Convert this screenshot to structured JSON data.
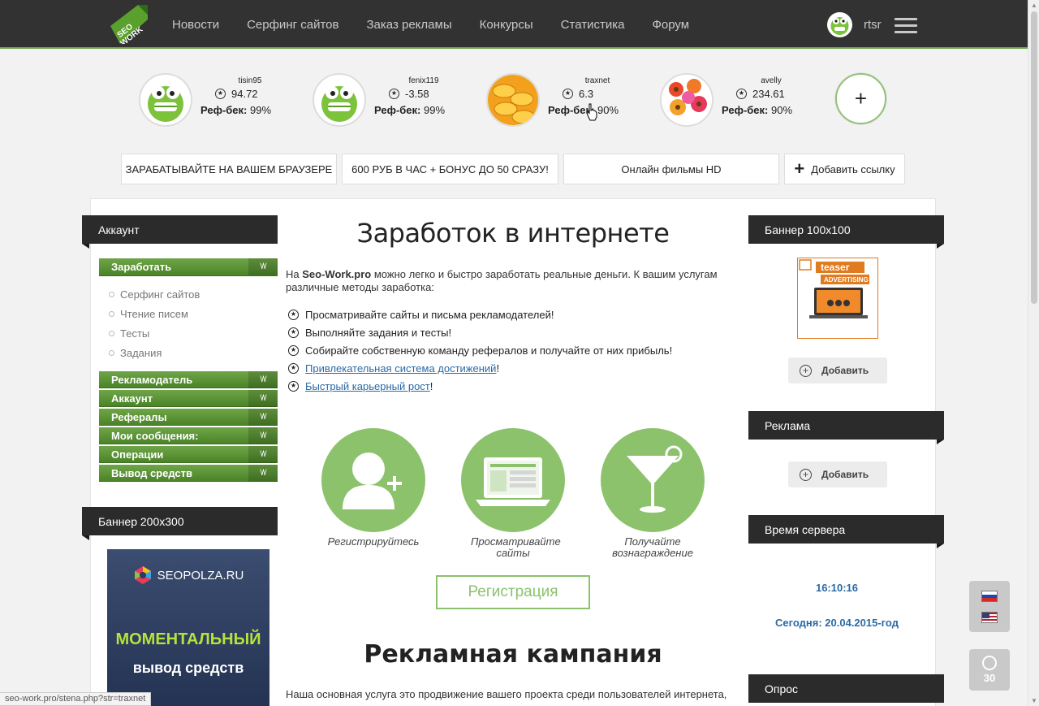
{
  "header": {
    "logo_text": "SEO WORK",
    "nav": [
      "Новости",
      "Серфинг сайтов",
      "Заказ рекламы",
      "Конкурсы",
      "Статистика",
      "Форум"
    ],
    "username": "rtsr"
  },
  "referrals": [
    {
      "nick": "tisin95",
      "points": "94.72",
      "label": "Реф-бек:",
      "value": "99%"
    },
    {
      "nick": "fenix119",
      "points": "-3.58",
      "label": "Реф-бек:",
      "value": "99%"
    },
    {
      "nick": "traxnet",
      "points": "6.3",
      "label": "Реф-бек:",
      "value": "90%"
    },
    {
      "nick": "avelly",
      "points": "234.61",
      "label": "Реф-бек:",
      "value": "90%"
    }
  ],
  "add_ref": "+",
  "links": [
    "ЗАРАБАТЫВАЙТЕ НА ВАШЕМ БРАУЗЕРЕ",
    "600 РУБ В ЧАС + БОНУС ДО 50 СРАЗУ!",
    "Онлайн фильмы HD",
    "Добавить ссылку"
  ],
  "left": {
    "account_title": "Аккаунт",
    "earn": "Заработать",
    "earn_items": [
      "Серфинг сайтов",
      "Чтение писем",
      "Тесты",
      "Задания"
    ],
    "sections": [
      "Рекламодатель",
      "Аккаунт",
      "Рефералы",
      "Мои сообщения:",
      "Операции",
      "Вывод средств"
    ],
    "chev": "\\/\\/",
    "banner_title": "Баннер 200x300",
    "banner": {
      "site": "SEOPOLZA.RU",
      "line1": "МОМЕНТАЛЬНЫЙ",
      "line2": "вывод средств"
    }
  },
  "center": {
    "title": "Заработок в интернете",
    "intro_pre": "На ",
    "intro_brand": "Seo-Work.pro",
    "intro_post": " можно легко и быстро заработать реальные деньги. К вашим услугам различные методы заработка:",
    "list": [
      "Просматривайте сайты и письма рекламодателей!",
      "Выполняйте задания и тесты!",
      "Собирайте собственную команду рефералов и получайте от них прибыль!"
    ],
    "links": [
      {
        "text": "Привлекательная система достижений",
        "tail": "!"
      },
      {
        "text": "Быстрый карьерный рост",
        "tail": "!"
      }
    ],
    "steps": [
      "Регистрируйтесь",
      "Просматривайте сайты",
      "Получайте вознаграждение"
    ],
    "register": "Регистрация",
    "title2": "Рекламная кампания",
    "para2": "Наша основная услуга это продвижение вашего проекта среди пользователей интернета,"
  },
  "right": {
    "banner_title": "Баннер 100x100",
    "teaser_text": "teaser",
    "teaser_sub": "ADVERTISING",
    "add": "Добавить",
    "ads_title": "Реклама",
    "time_title": "Время сервера",
    "time": "16:10:16",
    "date": "Сегодня: 20.04.2015-год",
    "poll_title": "Опрос"
  },
  "widgets": {
    "online": "30"
  },
  "statusbar": "seo-work.pro/stena.php?str=traxnet",
  "colors": {
    "accent": "#8cc26c",
    "dark": "#2b2b2b",
    "link": "#2a6aa6"
  }
}
